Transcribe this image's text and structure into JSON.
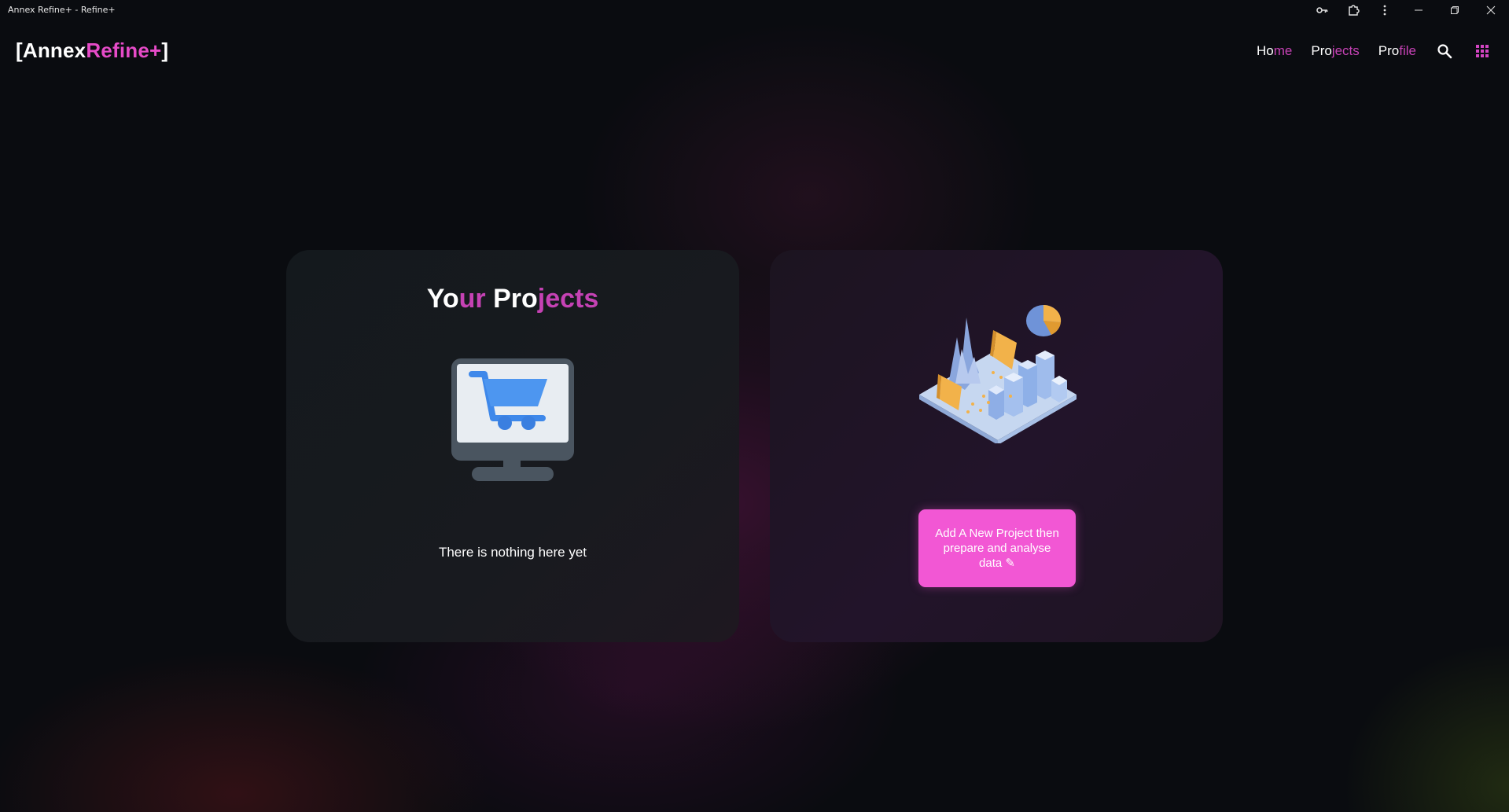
{
  "window": {
    "title": "Annex Refine+ - Refine+",
    "icons": [
      "key-icon",
      "extensions-icon",
      "more-vert-icon",
      "minimize-icon",
      "restore-icon",
      "close-icon"
    ]
  },
  "logo": {
    "bracket_open": "[",
    "part1": "Annex",
    "part2": "Refine+",
    "bracket_close": "]"
  },
  "nav": {
    "home": {
      "a": "Ho",
      "b": "me"
    },
    "projects": {
      "a": "Pro",
      "b": "jects"
    },
    "profile": {
      "a": "Pro",
      "b": "file"
    },
    "icons": [
      "search-icon",
      "apps-grid-icon"
    ]
  },
  "projects_card": {
    "title": {
      "a": "Yo",
      "b": "ur",
      "c": "Pro",
      "d": "jects"
    },
    "empty_icon": "monitor-cart-icon",
    "empty_text": "There is nothing here yet"
  },
  "new_project_card": {
    "illustration": "data-analytics-city-illustration",
    "button_label": "Add A New Project then prepare and analyse data ✎"
  },
  "colors": {
    "background": "#0a0c10",
    "accent_pink": "#c542b4",
    "button_pink": "#f257d4",
    "card_left": "#161a1f",
    "card_right": "#20142a"
  }
}
